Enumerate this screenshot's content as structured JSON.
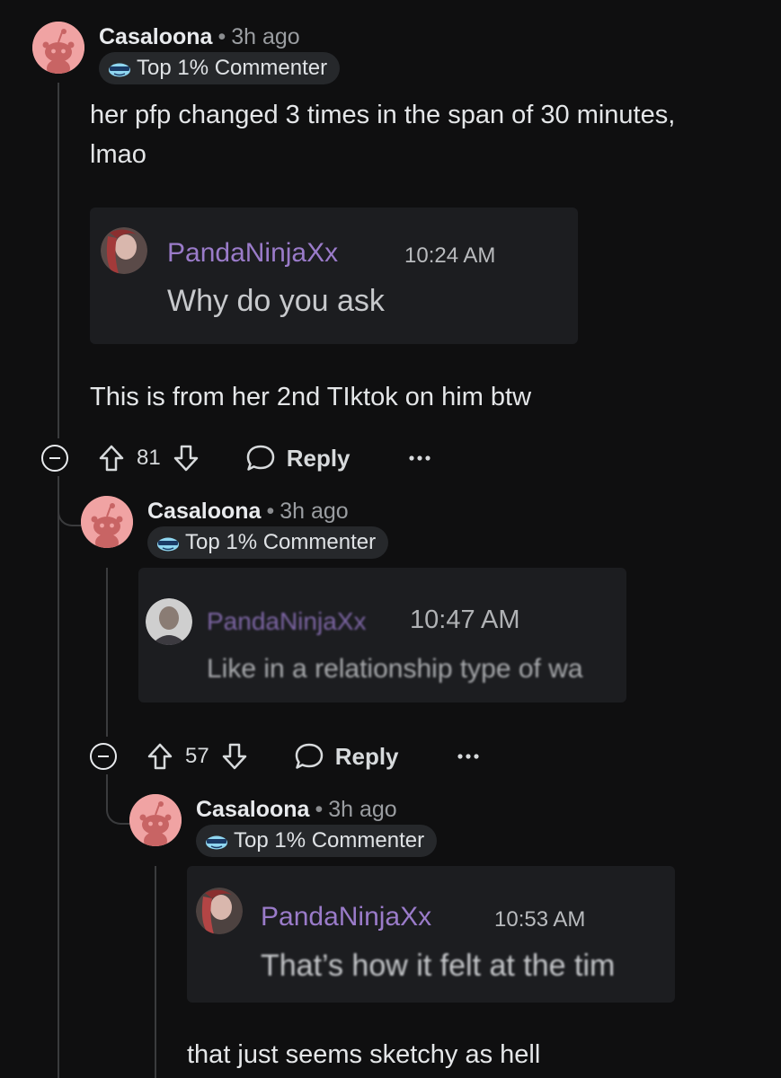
{
  "comments": [
    {
      "username": "Casaloona",
      "separator": "•",
      "timestamp": "3h ago",
      "flair": "Top 1% Commenter",
      "body_lines": [
        "her pfp changed 3 times in the span of 30 minutes,",
        "lmao"
      ],
      "embed": {
        "name": "PandaNinjaXx",
        "time": "10:24 AM",
        "message": "Why do you ask"
      },
      "after_text": "This is from her 2nd TIktok on him btw",
      "score": "81",
      "reply_label": "Reply"
    },
    {
      "username": "Casaloona",
      "separator": "•",
      "timestamp": "3h ago",
      "flair": "Top 1% Commenter",
      "embed": {
        "name": "PandaNinjaXx",
        "time": "10:47 AM",
        "message": "Like in a relationship type of wa"
      },
      "score": "57",
      "reply_label": "Reply"
    },
    {
      "username": "Casaloona",
      "separator": "•",
      "timestamp": "3h ago",
      "flair": "Top 1% Commenter",
      "embed": {
        "name": "PandaNinjaXx",
        "time": "10:53 AM",
        "message": "That’s how it felt at the tim"
      },
      "after_text": "that just seems sketchy as hell"
    }
  ],
  "icons": {
    "upvote": "upvote-arrow-icon",
    "downvote": "downvote-arrow-icon",
    "reply": "speech-bubble-icon",
    "more": "ellipsis-icon",
    "collapse": "minus-circle-icon",
    "flair": "sunglasses-snoo-icon",
    "avatar": "snoo-avatar-icon"
  },
  "colors": {
    "background": "#0f0f10",
    "avatar": "#f0a3a3",
    "embed_background": "#1c1d20",
    "embed_name": "#9a7bc9"
  }
}
